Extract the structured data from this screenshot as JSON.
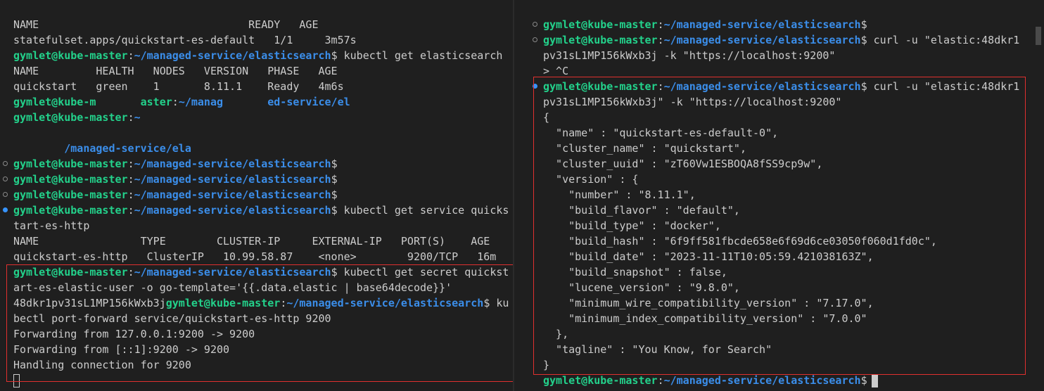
{
  "left_terminal": {
    "lines": [
      [
        "NAME                                 READY   AGE"
      ],
      [
        "statefulset.apps/quickstart-es-default   1/1     3m57s"
      ],
      [
        "gymlet@kube-master:~/managed-service/elasticsearch$ kubectl get elasticsearch"
      ],
      [
        "NAME         HEALTH   NODES   VERSION   PHASE   AGE"
      ],
      [
        "quickstart   green    1       8.11.1    Ready   4m6s"
      ],
      [
        "gymlet@kube-m       aster:~/manag       ed-service/el"
      ],
      [
        "gymlet@kube-master:~"
      ],
      [
        ""
      ],
      [
        "        /managed-service/ela"
      ],
      [
        "gymlet@kube-master:~/managed-service/elasticsearch$"
      ],
      [
        "gymlet@kube-master:~/managed-service/elasticsearch$"
      ],
      [
        "gymlet@kube-master:~/managed-service/elasticsearch$"
      ],
      [
        "gymlet@kube-master:~/managed-service/elasticsearch$ kubectl get service quicks"
      ],
      [
        "tart-es-http"
      ],
      [
        "NAME                TYPE        CLUSTER-IP     EXTERNAL-IP   PORT(S)    AGE"
      ],
      [
        "quickstart-es-http   ClusterIP   10.99.58.87    <none>        9200/TCP   16m"
      ],
      [
        "gymlet@kube-master:~/managed-service/elasticsearch$ kubectl get secret quickst"
      ],
      [
        "art-es-elastic-user -o go-template='{{.data.elastic | base64decode}}'"
      ],
      [
        "48dkr1pv31sL1MP156kWxb3jgymlet@kube-master:~/managed-service/elasticsearch$ ku"
      ],
      [
        "bectl port-forward service/quickstart-es-http 9200"
      ],
      [
        "Forwarding from 127.0.0.1:9200 -> 9200"
      ],
      [
        "Forwarding from [::1]:9200 -> 9200"
      ],
      [
        "Handling connection for 9200"
      ]
    ]
  },
  "right_terminal": {
    "lines": [
      [
        "gymlet@kube-master:~/managed-service/elasticsearch$"
      ],
      [
        "gymlet@kube-master:~/managed-service/elasticsearch$ curl -u \"elastic:48dkr1"
      ],
      [
        "pv31sL1MP156kWxb3j -k \"https://localhost:9200\""
      ],
      [
        "> ^C"
      ],
      [
        "gymlet@kube-master:~/managed-service/elasticsearch$ curl -u \"elastic:48dkr1"
      ],
      [
        "pv31sL1MP156kWxb3j\" -k \"https://localhost:9200\""
      ],
      [
        "{"
      ],
      [
        "  \"name\" : \"quickstart-es-default-0\","
      ],
      [
        "  \"cluster_name\" : \"quickstart\","
      ],
      [
        "  \"cluster_uuid\" : \"zT60Vw1ESBOQA8fSS9cp9w\","
      ],
      [
        "  \"version\" : {"
      ],
      [
        "    \"number\" : \"8.11.1\","
      ],
      [
        "    \"build_flavor\" : \"default\","
      ],
      [
        "    \"build_type\" : \"docker\","
      ],
      [
        "    \"build_hash\" : \"6f9ff581fbcde658e6f69d6ce03050f060d1fd0c\","
      ],
      [
        "    \"build_date\" : \"2023-11-11T10:05:59.421038163Z\","
      ],
      [
        "    \"build_snapshot\" : false,"
      ],
      [
        "    \"lucene_version\" : \"9.8.0\","
      ],
      [
        "    \"minimum_wire_compatibility_version\" : \"7.17.0\","
      ],
      [
        "    \"minimum_index_compatibility_version\" : \"7.0.0\""
      ],
      [
        "  },"
      ],
      [
        "  \"tagline\" : \"You Know, for Search\""
      ],
      [
        "}"
      ],
      [
        "gymlet@kube-master:~/managed-service/elasticsearch$"
      ]
    ]
  },
  "colors": {
    "background": "#1f1f1f",
    "text": "#cccccc",
    "prompt_user": "#23d18b",
    "prompt_path": "#3b8eea",
    "highlight_box": "#e0302f",
    "status_dot": "#3794ff"
  }
}
